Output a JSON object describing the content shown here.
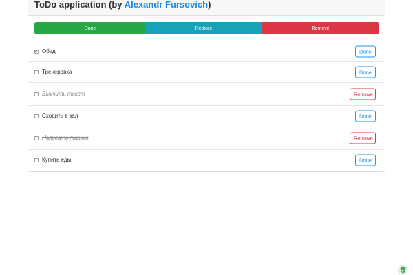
{
  "header": {
    "title_prefix": "ToDo application (by ",
    "author": "Alexandr Fursovich",
    "title_suffix": ")"
  },
  "actions": {
    "done_label": "Done",
    "restore_label": "Restore",
    "remove_label": "Remove"
  },
  "todos": [
    {
      "label": "Обед",
      "checked": true,
      "completed": false,
      "button": "Done"
    },
    {
      "label": "Тренеровка",
      "checked": false,
      "completed": false,
      "button": "Done"
    },
    {
      "label": "Выучить текст",
      "checked": false,
      "completed": true,
      "button": "Remove"
    },
    {
      "label": "Сходить в зал",
      "checked": false,
      "completed": false,
      "button": "Done"
    },
    {
      "label": "Написать письмо",
      "checked": false,
      "completed": true,
      "button": "Remove"
    },
    {
      "label": "Купить еды",
      "checked": false,
      "completed": false,
      "button": "Done"
    }
  ],
  "colors": {
    "done": "#28a745",
    "restore": "#17a2b8",
    "remove": "#dc3545",
    "link": "#1e88e5"
  },
  "icons": {
    "checkmark": "check-icon",
    "shield": "shield-icon"
  }
}
